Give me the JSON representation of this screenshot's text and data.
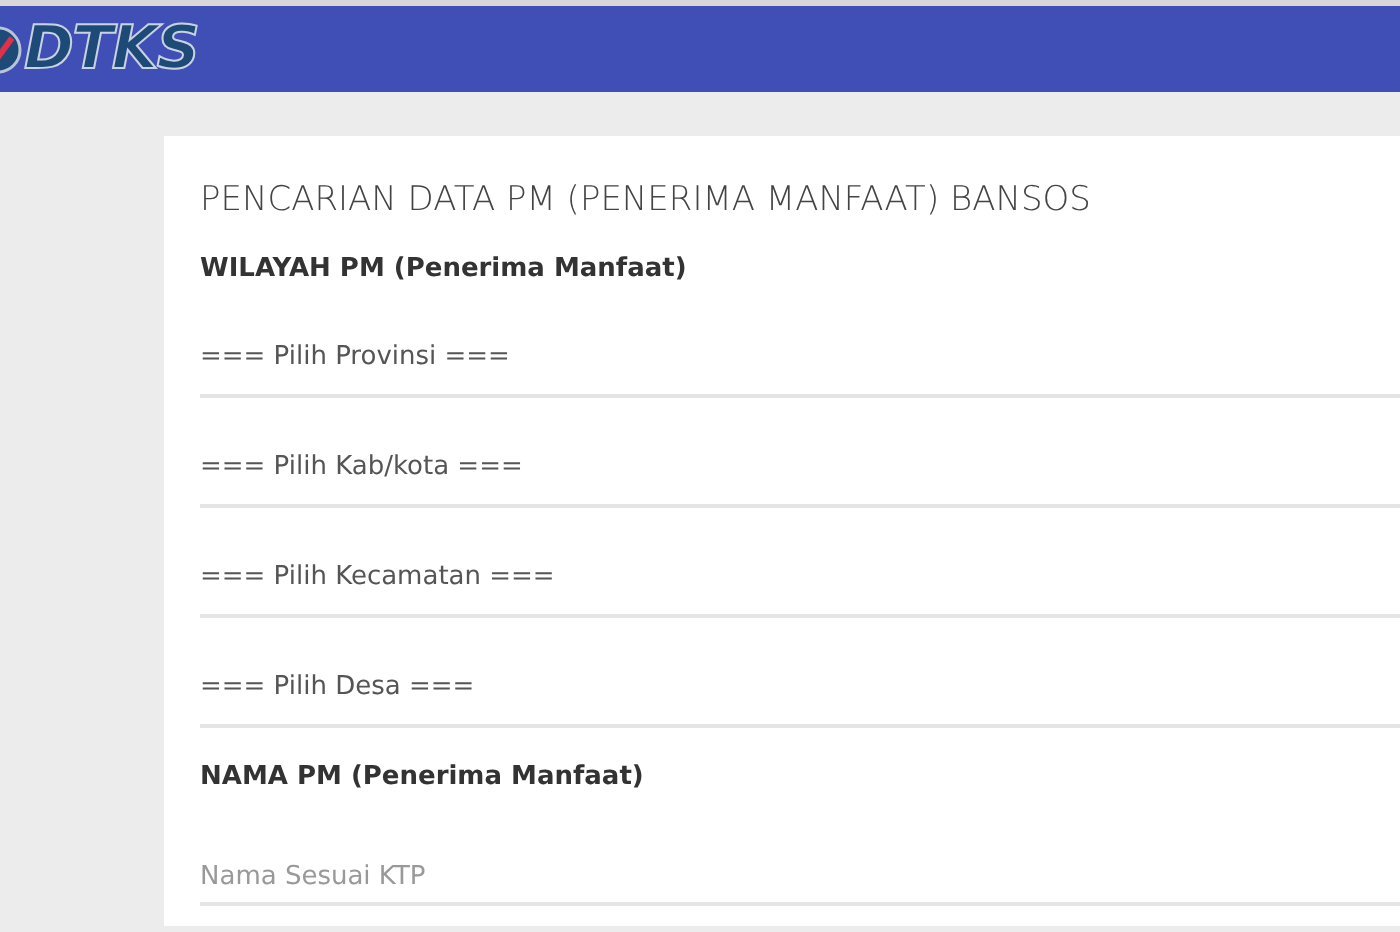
{
  "header": {
    "logo_text": "DTKS"
  },
  "form": {
    "title": "PENCARIAN DATA PM (PENERIMA MANFAAT) BANSOS",
    "sections": [
      {
        "heading": "WILAYAH PM (Penerima Manfaat)",
        "fields": [
          {
            "kind": "select",
            "value": "=== Pilih Provinsi ==="
          },
          {
            "kind": "select",
            "value": "=== Pilih Kab/kota ==="
          },
          {
            "kind": "select",
            "value": "=== Pilih Kecamatan ==="
          },
          {
            "kind": "select",
            "value": "=== Pilih Desa ==="
          }
        ]
      },
      {
        "heading": "NAMA PM (Penerima Manfaat)",
        "fields": [
          {
            "kind": "text",
            "placeholder": "Nama Sesuai KTP"
          }
        ]
      }
    ]
  }
}
